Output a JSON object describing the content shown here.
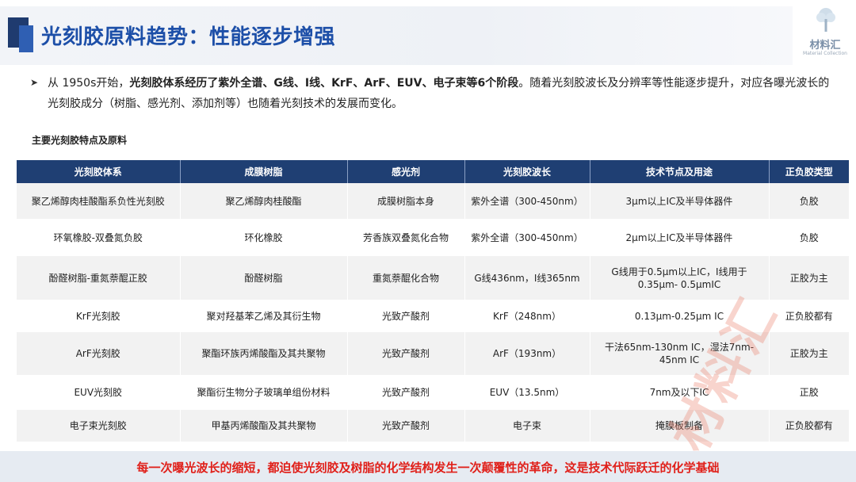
{
  "header": {
    "title": "光刻胶原料趋势：性能逐步增强"
  },
  "logo": {
    "name": "材料汇",
    "subtitle": "Material Collection"
  },
  "intro": {
    "prefix": "从  1950s开始，",
    "bold": "光刻胶体系经历了紫外全谱、G线、I线、KrF、ArF、EUV、电子束等6个阶段",
    "suffix": "。随着光刻胶波长及分辨率等性能逐步提升，对应各曝光波长的光刻胶成分（树脂、感光剂、添加剂等）也随着光刻技术的发展而变化。"
  },
  "table_heading": "主要光刻胶特点及原料",
  "table": {
    "columns": [
      "光刻胶体系",
      "成膜树脂",
      "感光剂",
      "光刻胶波长",
      "技术节点及用途",
      "正负胶类型"
    ],
    "rows": [
      [
        "聚乙烯醇肉桂酸酯系负性光刻胶",
        "聚乙烯醇肉桂酸酯",
        "成膜树脂本身",
        "紫外全谱（300-450nm）",
        "3μm以上IC及半导体器件",
        "负胶"
      ],
      [
        "环氧橡胶-双叠氮负胶",
        "环化橡胶",
        "芳香族双叠氮化合物",
        "紫外全谱（300-450nm）",
        "2μm以上IC及半导体器件",
        "负胶"
      ],
      [
        "酚醛树脂-重氮萘醌正胶",
        "酚醛树脂",
        "重氮萘醌化合物",
        "G线436nm，I线365nm",
        "G线用于0.5μm以上IC，I线用于0.35μm- 0.5μmIC",
        "正胶为主"
      ],
      [
        "KrF光刻胶",
        "聚对羟基苯乙烯及其衍生物",
        "光致产酸剂",
        "KrF（248nm）",
        "0.13μm-0.25μm IC",
        "正负胶都有"
      ],
      [
        "ArF光刻胶",
        "聚酯环族丙烯酸酯及其共聚物",
        "光致产酸剂",
        "ArF（193nm）",
        "干法65nm-130nm IC，湿法7nm-45nm IC",
        "正胶为主"
      ],
      [
        "EUV光刻胶",
        "聚酯衍生物分子玻璃单组份材料",
        "光致产酸剂",
        "EUV（13.5nm）",
        "7nm及以下IC",
        "正胶"
      ],
      [
        "电子束光刻胶",
        "甲基丙烯酸酯及其共聚物",
        "光致产酸剂",
        "电子束",
        "掩膜板制备",
        "正负胶都有"
      ]
    ]
  },
  "watermark": "材料汇",
  "footer": {
    "text": "每一次曝光波长的缩短，都迫使光刻胶及树脂的化学结构发生一次颠覆性的革命，这是技术代际跃迁的化学基础"
  },
  "colors": {
    "title": "#1d4fa8",
    "table_header": "#1f3f73",
    "footer_text": "#e0201a",
    "watermark": "#e87864"
  }
}
